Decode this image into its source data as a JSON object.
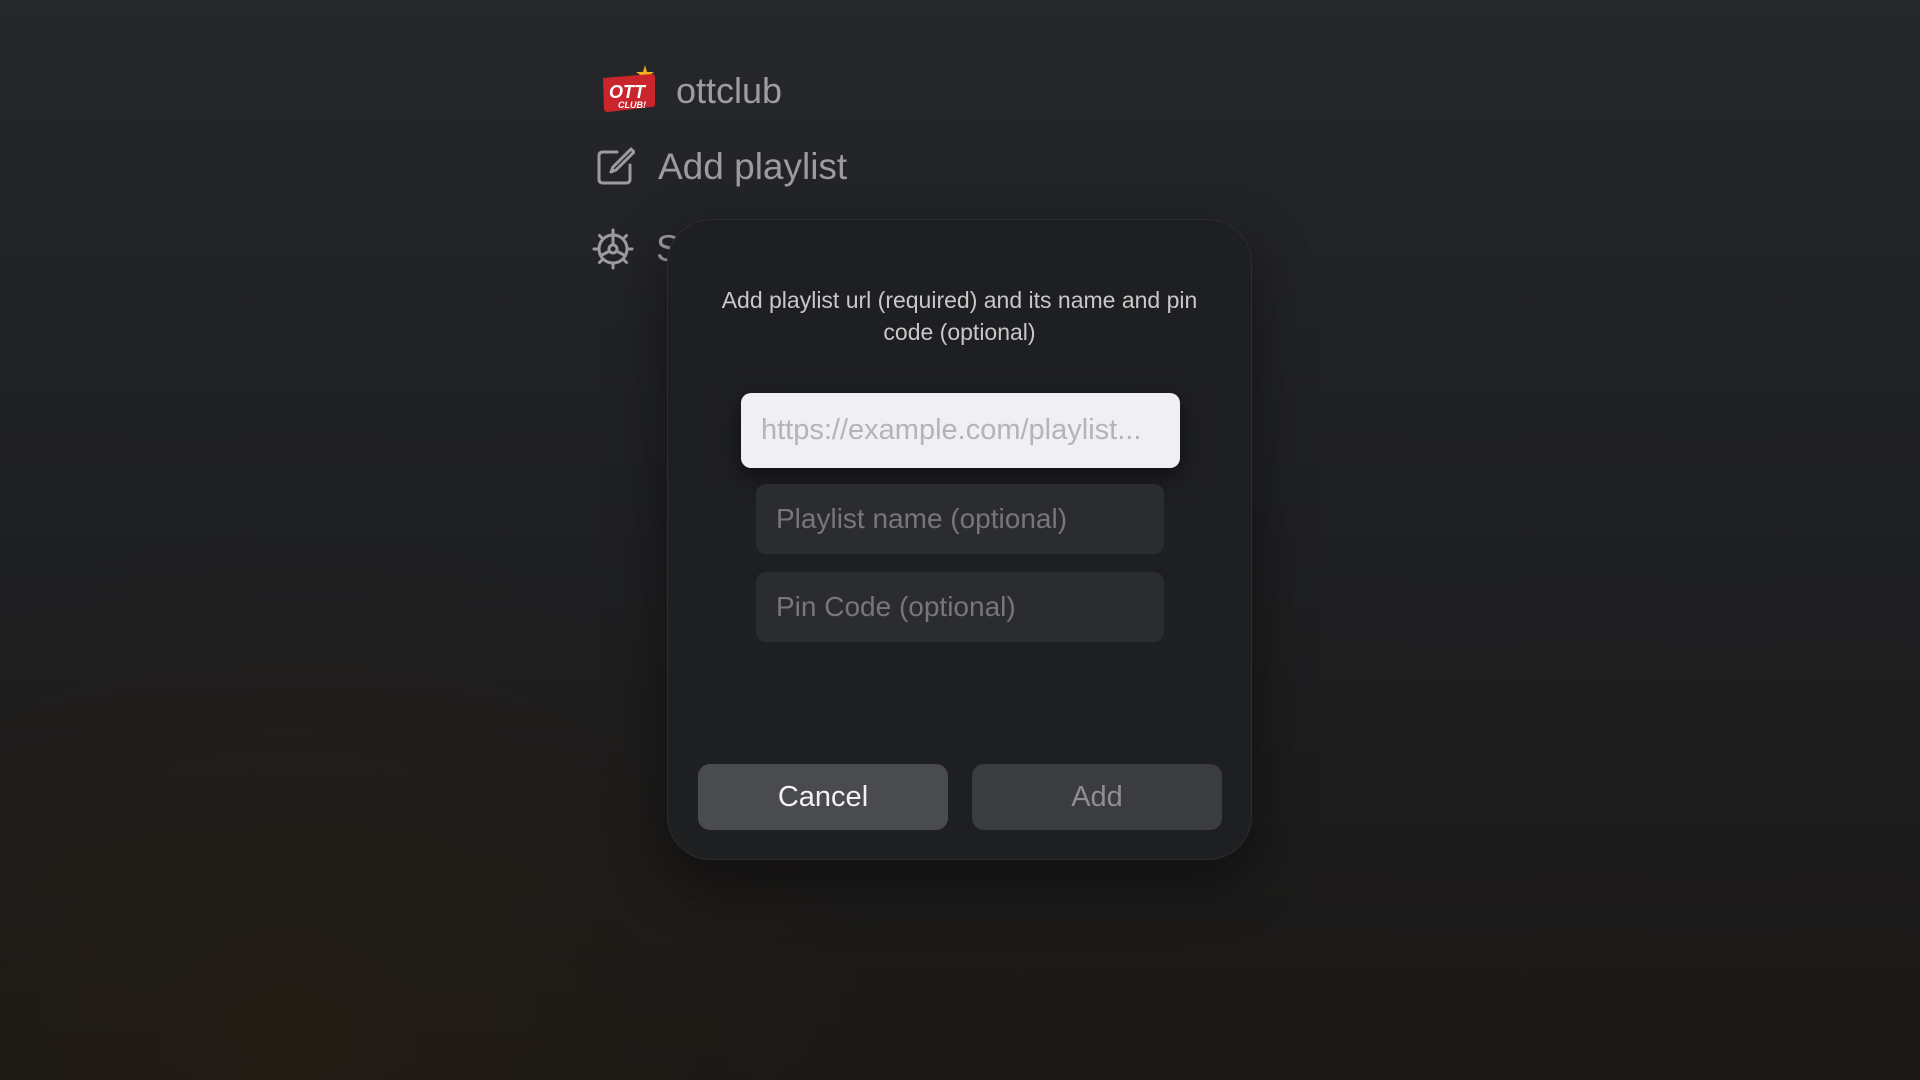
{
  "menu": {
    "brand": {
      "name": "ottclub",
      "logo_text_top": "OTT",
      "logo_text_bottom": "CLUB!",
      "icon": "ottclub-logo"
    },
    "add_playlist": {
      "label": "Add playlist",
      "icon": "edit-icon"
    },
    "settings": {
      "label": "S",
      "icon": "gear-icon"
    }
  },
  "dialog": {
    "message": "Add playlist url (required) and its name and pin code (optional)",
    "url_field": {
      "placeholder": "https://example.com/playlist...",
      "value": ""
    },
    "name_field": {
      "placeholder": "Playlist name (optional)",
      "value": ""
    },
    "pin_field": {
      "placeholder": "Pin Code (optional)",
      "value": ""
    },
    "cancel_label": "Cancel",
    "add_label": "Add"
  },
  "colors": {
    "background": "#222326",
    "dialog": "#1e1f21",
    "focused_field": "#f0f0f2",
    "logo_red": "#c8262c",
    "logo_star": "#f2b01e"
  }
}
